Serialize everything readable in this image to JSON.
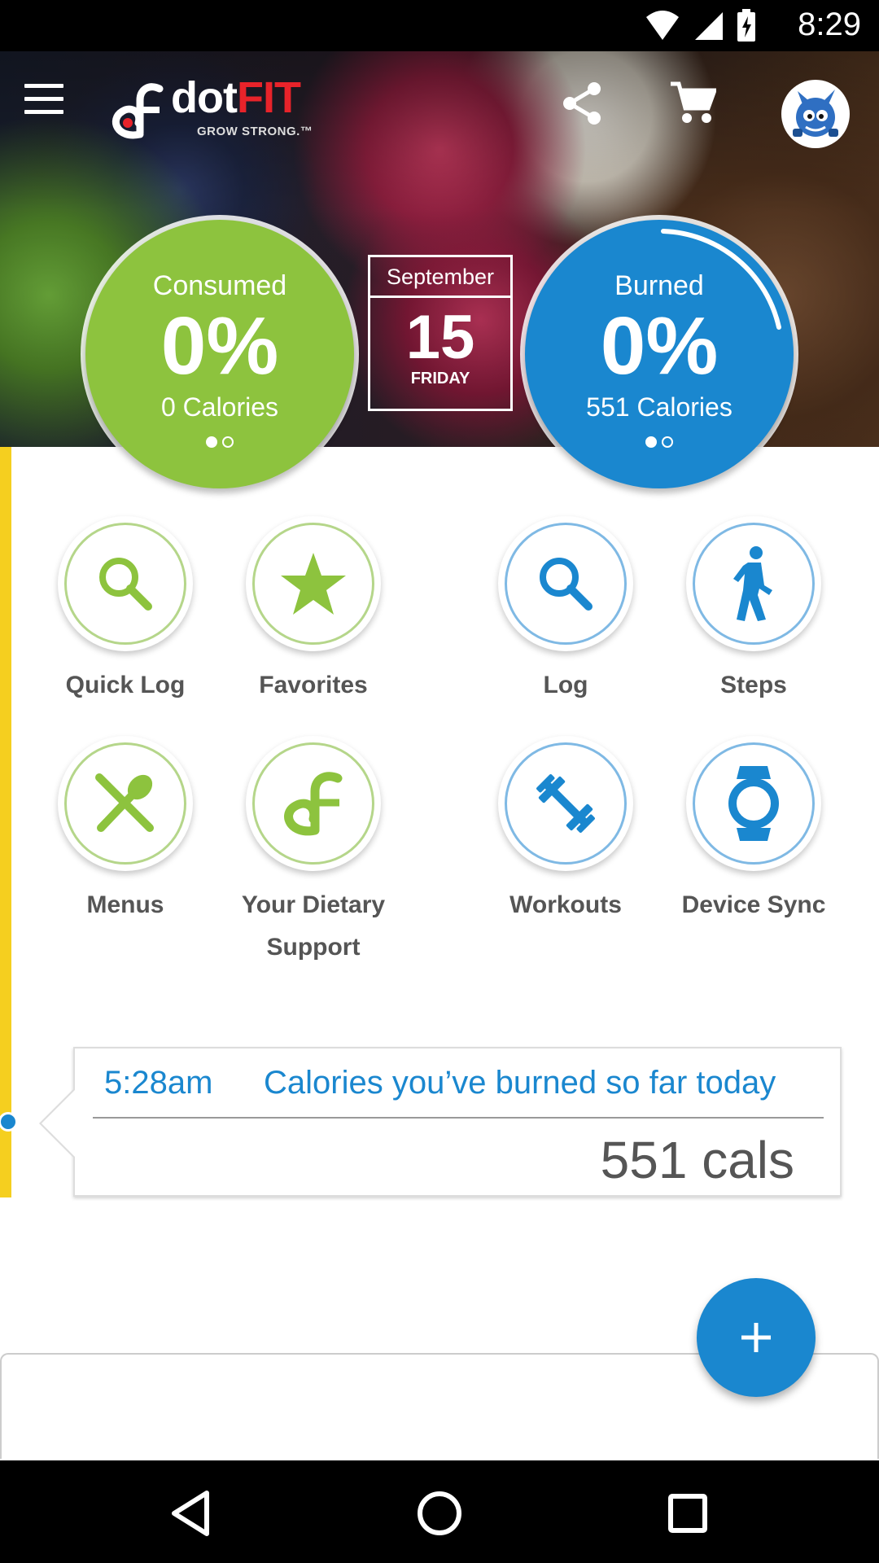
{
  "status_bar": {
    "time": "8:29"
  },
  "header": {
    "brand_prefix": "dot",
    "brand_suffix": "FIT",
    "tagline": "GROW STRONG.™"
  },
  "consumed": {
    "title": "Consumed",
    "percent": "0%",
    "calories": "0 Calories"
  },
  "date": {
    "month": "September",
    "day": "15",
    "weekday": "FRIDAY"
  },
  "burned": {
    "title": "Burned",
    "percent": "0%",
    "calories": "551 Calories"
  },
  "tiles": {
    "quick_log": "Quick Log",
    "favorites": "Favorites",
    "log": "Log",
    "steps": "Steps",
    "menus": "Menus",
    "dietary_support_line1": "Your Dietary",
    "dietary_support_line2": "Support",
    "workouts": "Workouts",
    "device_sync": "Device Sync"
  },
  "timeline": {
    "time": "5:28am",
    "description": "Calories you’ve burned so far today",
    "value": "551 cals"
  },
  "colors": {
    "green": "#8dc33e",
    "blue": "#1a87cf",
    "accent_yellow": "#f5cf1f",
    "brand_red": "#e8232a"
  }
}
